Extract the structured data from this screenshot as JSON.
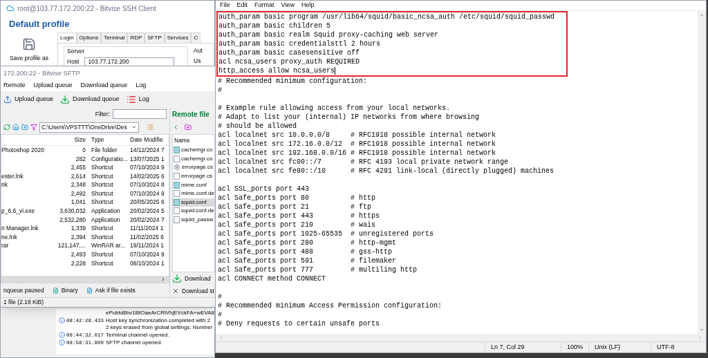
{
  "ssh_client": {
    "title": "root@103.77.172.200:22 - Bitvise SSH Client",
    "profile_title": "Default profile",
    "save_button": "Save profile as",
    "tabs": [
      {
        "label": "Login",
        "selected": true
      },
      {
        "label": "Options",
        "selected": false
      },
      {
        "label": "Terminal",
        "selected": false
      },
      {
        "label": "RDP",
        "selected": false
      },
      {
        "label": "SFTP",
        "selected": false
      },
      {
        "label": "Services",
        "selected": false
      },
      {
        "label": "C",
        "selected": false
      }
    ],
    "server_group": {
      "label": "Server",
      "host_label": "Host",
      "host_value": "103.77.172.200"
    },
    "auth_group": {
      "label": "Aut",
      "user_label": "Us"
    },
    "log": [
      {
        "kind": "plain",
        "lines": [
          "ePubtd6bv1BfOaeArCRiVhjEVckFA+wEVA8"
        ]
      },
      {
        "kind": "info",
        "time": "08:42:28.433",
        "lines": [
          "Host key synchronization completed with 2",
          "2 keys erased from global settings. Number"
        ]
      },
      {
        "kind": "info",
        "time": "08:44:32.017",
        "lines": [
          "Terminal channel opened."
        ]
      },
      {
        "kind": "info",
        "time": "08:58:31.900",
        "lines": [
          "SFTP channel opened."
        ]
      }
    ]
  },
  "sftp": {
    "title": "172.200:22 - Bitvise SFTP",
    "menu": [
      "Remote",
      "Upload queue",
      "Download queue",
      "Log"
    ],
    "toolbar": [
      {
        "kind": "upload",
        "label": "Upload queue"
      },
      {
        "kind": "download",
        "label": "Download queue"
      },
      {
        "kind": "log",
        "label": "Log"
      }
    ],
    "filter_label": "Filter:",
    "path": "C:\\Users\\VPSTTT\\OneDrive\\Des",
    "local_columns": [
      "Size",
      "Type",
      "Date Modifie"
    ],
    "local_files": [
      {
        "name": "Photoshop 2020",
        "size": "0",
        "type": "File folder",
        "date": "14/12/2024 7"
      },
      {
        "size": "282",
        "type": "Configuratio...",
        "date": "13/07/2025 1"
      },
      {
        "size": "2,455",
        "type": "Shortcut",
        "date": "07/10/2024 9"
      },
      {
        "name": "ester.lnk",
        "size": "2,614",
        "type": "Shortcut",
        "date": "14/02/2025 6"
      },
      {
        "name": "nk",
        "size": "2,348",
        "type": "Shortcut",
        "date": "07/10/2024 8"
      },
      {
        "size": "2,492",
        "type": "Shortcut",
        "date": "07/10/2024 9"
      },
      {
        "size": "1,041",
        "type": "Shortcut",
        "date": "20/05/2025 6"
      },
      {
        "name": "p_6.6_vi.exe",
        "size": "3,630,032",
        "type": "Application",
        "date": "20/02/2024 5"
      },
      {
        "size": "2,532,280",
        "type": "Application",
        "date": "20/02/2024 7"
      },
      {
        "name": "n Manager.lnk",
        "size": "1,339",
        "type": "Shortcut",
        "date": "11/11/2024 1"
      },
      {
        "name": "ne.lnk",
        "size": "2,394",
        "type": "Shortcut",
        "date": "11/02/2025 6"
      },
      {
        "name": "rar",
        "size": "121,147,...",
        "type": "WinRAR ar...",
        "date": "19/11/2024 1"
      },
      {
        "size": "2,493",
        "type": "Shortcut",
        "date": "07/10/2024 9"
      },
      {
        "size": "2,228",
        "type": "Shortcut",
        "date": "08/10/2024 1"
      }
    ],
    "remote_title": "Remote file",
    "remote_column": "Name",
    "remote_files": [
      {
        "kind": "config",
        "name": "cachemgr.co",
        "selected": false
      },
      {
        "kind": "file",
        "name": "cachemgr.co",
        "selected": false
      },
      {
        "kind": "style",
        "name": "errorpage.cs",
        "selected": false
      },
      {
        "kind": "file",
        "name": "errorpage.cs",
        "selected": false
      },
      {
        "kind": "config",
        "name": "mime.conf",
        "selected": false
      },
      {
        "kind": "file",
        "name": "mime.conf.de",
        "selected": false
      },
      {
        "kind": "config",
        "name": "squid.conf",
        "selected": true
      },
      {
        "kind": "file",
        "name": "squid.conf.de",
        "selected": false
      },
      {
        "kind": "file",
        "name": "squid_passw",
        "selected": false
      }
    ],
    "remote_buttons": [
      {
        "kind": "download",
        "label": "Download"
      },
      {
        "kind": "stop",
        "label": "Download st"
      }
    ],
    "queue_status": "nqueue paused",
    "transfer_mode": "Binary",
    "overwrite_mode": "Ask if file exists",
    "footer": "1 file (2.19 KiB)"
  },
  "notepad": {
    "menu": [
      "File",
      "Edit",
      "Format",
      "View",
      "Help"
    ],
    "highlighted_lines": [
      "auth_param basic program /usr/lib64/squid/basic_ncsa_auth /etc/squid/squid_passwd",
      "auth_param basic children 5",
      "auth_param basic realm Squid proxy-caching web server",
      "auth_param basic credentialsttl 2 hours",
      "auth_param basic casesensitive off",
      "acl ncsa_users proxy_auth REQUIRED",
      "http_access allow ncsa_users"
    ],
    "lines": [
      {
        "kind": "code",
        "text": "# Recommended minimum configuration:"
      },
      {
        "kind": "code",
        "text": "#"
      },
      {
        "kind": "blank"
      },
      {
        "kind": "code",
        "text": "# Example rule allowing access from your local networks."
      },
      {
        "kind": "code",
        "text": "# Adapt to list your (internal) IP networks from where browsing"
      },
      {
        "kind": "code",
        "text": "# should be allowed"
      },
      {
        "kind": "code",
        "text": "acl localnet src 10.0.0.0/8     # RFC1918 possible internal network"
      },
      {
        "kind": "code",
        "text": "acl localnet src 172.16.0.0/12  # RFC1918 possible internal network"
      },
      {
        "kind": "code",
        "text": "acl localnet src 192.168.0.0/16 # RFC1918 possible internal network"
      },
      {
        "kind": "code",
        "text": "acl localnet src fc00::/7       # RFC 4193 local private network range"
      },
      {
        "kind": "code",
        "text": "acl localnet src fe80::/10      # RFC 4291 link-local (directly plugged) machines"
      },
      {
        "kind": "blank"
      },
      {
        "kind": "code",
        "text": "acl SSL_ports port 443"
      },
      {
        "kind": "code",
        "text": "acl Safe_ports port 80          # http"
      },
      {
        "kind": "code",
        "text": "acl Safe_ports port 21          # ftp"
      },
      {
        "kind": "code",
        "text": "acl Safe_ports port 443         # https"
      },
      {
        "kind": "code",
        "text": "acl Safe_ports port 210         # wais"
      },
      {
        "kind": "code",
        "text": "acl Safe_ports port 1025-65535  # unregistered ports"
      },
      {
        "kind": "code",
        "text": "acl Safe_ports port 280         # http-mgmt"
      },
      {
        "kind": "code",
        "text": "acl Safe_ports port 488         # gss-http"
      },
      {
        "kind": "code",
        "text": "acl Safe_ports port 591         # filemaker"
      },
      {
        "kind": "code",
        "text": "acl Safe_ports port 777         # multiling http"
      },
      {
        "kind": "code",
        "text": "acl CONNECT method CONNECT"
      },
      {
        "kind": "blank"
      },
      {
        "kind": "code",
        "text": "#"
      },
      {
        "kind": "code",
        "text": "# Recommended minimum Access Permission configuration:"
      },
      {
        "kind": "code",
        "text": "#"
      },
      {
        "kind": "code",
        "text": "# Deny requests to certain unsafe ports"
      }
    ],
    "status": [
      "Ln 7, Col 29",
      "100%",
      "Unix (LF)",
      "UTF-8"
    ]
  }
}
